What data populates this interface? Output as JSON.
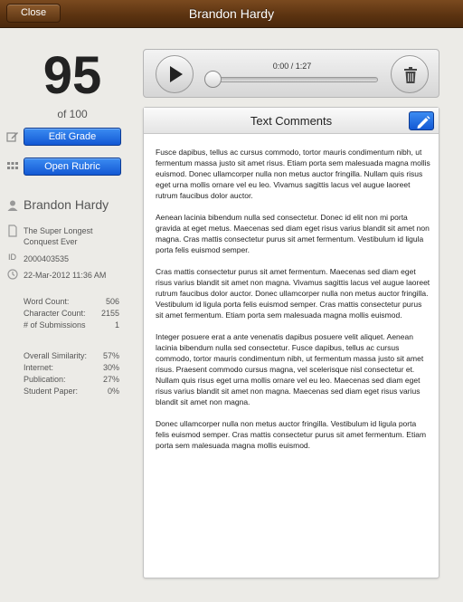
{
  "header": {
    "close_label": "Close",
    "title": "Brandon Hardy"
  },
  "grade": {
    "score": "95",
    "out_of": "of 100",
    "edit_label": "Edit Grade",
    "rubric_label": "Open Rubric"
  },
  "student": {
    "name": "Brandon Hardy",
    "assignment": "The Super Longest Conquest Ever",
    "id_label": "ID",
    "id": "2000403535",
    "date": "22-Mar-2012 11:36 AM"
  },
  "counts": [
    {
      "label": "Word Count:",
      "value": "506"
    },
    {
      "label": "Character Count:",
      "value": "2155"
    },
    {
      "label": "# of Submissions",
      "value": "1"
    }
  ],
  "similarity": [
    {
      "label": "Overall Similarity:",
      "value": "57%"
    },
    {
      "label": "Internet:",
      "value": "30%"
    },
    {
      "label": "Publication:",
      "value": "27%"
    },
    {
      "label": "Student Paper:",
      "value": "0%"
    }
  ],
  "audio": {
    "time": "0:00 / 1:27",
    "progress": 0
  },
  "icons": {
    "play": "play-icon",
    "trash": "trash-icon",
    "edit": "pencil-icon",
    "person": "person-icon",
    "document": "document-icon",
    "clock": "clock-icon",
    "grid": "grid-icon"
  },
  "colors": {
    "topbar": "#5a3210",
    "primary_button": "#1f6fe6"
  },
  "comments": {
    "title": "Text Comments",
    "paragraphs": [
      "Fusce dapibus, tellus ac cursus commodo, tortor mauris condimentum nibh, ut fermentum massa justo sit amet risus. Etiam porta sem malesuada magna mollis euismod. Donec ullamcorper nulla non metus auctor fringilla. Nullam quis risus eget urna mollis ornare vel eu leo. Vivamus sagittis lacus vel augue laoreet rutrum faucibus dolor auctor.",
      "Aenean lacinia bibendum nulla sed consectetur. Donec id elit non mi porta gravida at eget metus. Maecenas sed diam eget risus varius blandit sit amet non magna. Cras mattis consectetur purus sit amet fermentum. Vestibulum id ligula porta felis euismod semper.",
      "Cras mattis consectetur purus sit amet fermentum. Maecenas sed diam eget risus varius blandit sit amet non magna. Vivamus sagittis lacus vel augue laoreet rutrum faucibus dolor auctor. Donec ullamcorper nulla non metus auctor fringilla. Vestibulum id ligula porta felis euismod semper. Cras mattis consectetur purus sit amet fermentum. Etiam porta sem malesuada magna mollis euismod.",
      "Integer posuere erat a ante venenatis dapibus posuere velit aliquet. Aenean lacinia bibendum nulla sed consectetur. Fusce dapibus, tellus ac cursus commodo, tortor mauris condimentum nibh, ut fermentum massa justo sit amet risus. Praesent commodo cursus magna, vel scelerisque nisl consectetur et. Nullam quis risus eget urna mollis ornare vel eu leo. Maecenas sed diam eget risus varius blandit sit amet non magna. Maecenas sed diam eget risus varius blandit sit amet non magna.",
      "Donec ullamcorper nulla non metus auctor fringilla. Vestibulum id ligula porta felis euismod semper. Cras mattis consectetur purus sit amet fermentum. Etiam porta sem malesuada magna mollis euismod."
    ]
  }
}
